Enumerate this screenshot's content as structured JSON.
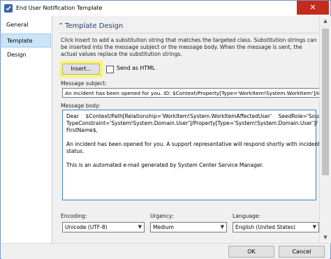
{
  "window": {
    "title": "End User Notification Template",
    "close_glyph": "✕"
  },
  "nav": {
    "items": [
      {
        "label": "General"
      },
      {
        "label": "Template Design"
      }
    ]
  },
  "section": {
    "chevron": "⌃",
    "title": "Template Design",
    "info": "Click Insert to add a substitution string that matches the targeted class. Substitution strings can be inserted into the message subject or the message body. When the message is sent, the actual values replace the substitution strings."
  },
  "insert_button": {
    "label": "Insert..."
  },
  "send_as_html": {
    "label": "Send as HTML",
    "checked": false
  },
  "message_subject": {
    "label": "Message subject:",
    "value": "An incident has been opened for you.  ID: $Context/Property[Type='WorkItem!System.WorkItem']/Id$"
  },
  "message_body": {
    "label": "Message body:",
    "lines": [
      "Dear    $Context/Path[Relationship='WorkItem!System.WorkItemAffectedUser'    SeedRole='Source'",
      "TypeConstraint='System!System.Domain.User']/Property[Type='System!System.Domain.User']/",
      "FirstName$,",
      "An incident has been opened for you. A support representative will respond shortly with incident",
      "status.",
      "This is an automated e-mail generated by System Center Service Manager."
    ]
  },
  "encoding": {
    "label": "Encoding:",
    "value": "Unicode (UTF-8)"
  },
  "urgency": {
    "label": "Urgency:",
    "value": "Medium"
  },
  "language": {
    "label": "Language:",
    "value": "English (United States)"
  },
  "footer": {
    "ok_label": "OK",
    "cancel_label": "Cancel"
  },
  "icons": {
    "app": "notification-template-icon",
    "dropdown": "chevron-down-icon",
    "close": "close-icon"
  },
  "colors": {
    "highlight": "#fbf66a",
    "selected_nav": "#cce4f7",
    "close": "#c42b1c",
    "section_title": "#1e3f6f"
  }
}
